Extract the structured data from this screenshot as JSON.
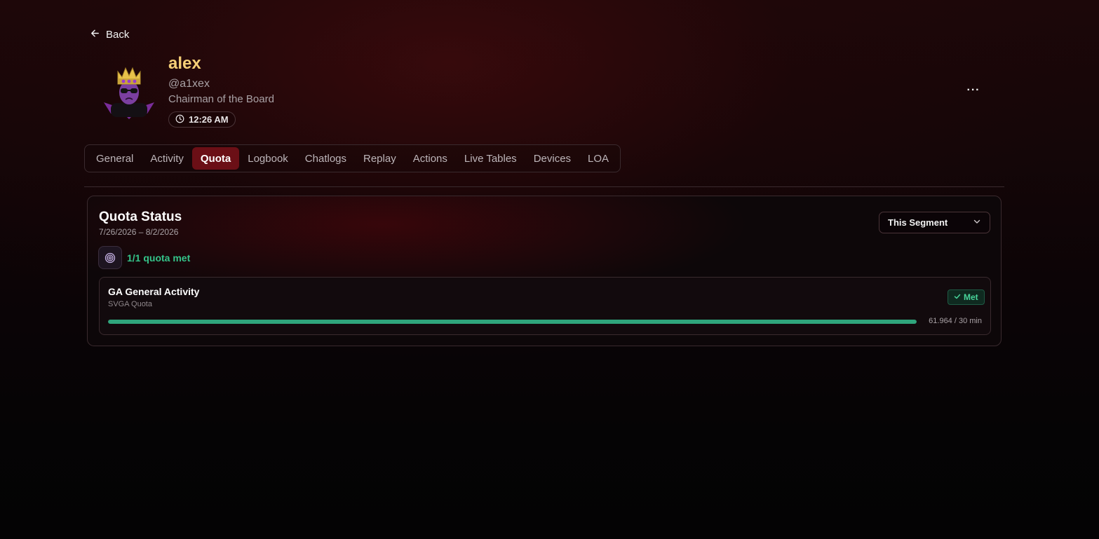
{
  "nav": {
    "back_label": "Back"
  },
  "profile": {
    "name": "alex",
    "handle": "@a1xex",
    "role": "Chairman of the Board",
    "local_time": "12:26 AM",
    "more_label": "···"
  },
  "tabs": [
    {
      "label": "General",
      "active": false
    },
    {
      "label": "Activity",
      "active": false
    },
    {
      "label": "Quota",
      "active": true
    },
    {
      "label": "Logbook",
      "active": false
    },
    {
      "label": "Chatlogs",
      "active": false
    },
    {
      "label": "Replay",
      "active": false
    },
    {
      "label": "Actions",
      "active": false
    },
    {
      "label": "Live Tables",
      "active": false
    },
    {
      "label": "Devices",
      "active": false
    },
    {
      "label": "LOA",
      "active": false
    }
  ],
  "quota": {
    "title": "Quota Status",
    "date_range": "7/26/2026 – 8/2/2026",
    "segment_select": "This Segment",
    "summary": "1/1 quota met",
    "items": [
      {
        "title": "GA General Activity",
        "subtitle": "SVGA Quota",
        "status": "Met",
        "progress_label": "61.964 / 30 min",
        "progress_fraction": 1.0
      }
    ]
  },
  "colors": {
    "accent_tab": "#6b0f16",
    "name_gold": "#f5cf77",
    "met_green": "#34c48a",
    "progress_green": "#2fa57c"
  },
  "icons": {
    "back": "arrow-left-icon",
    "clock": "clock-icon",
    "more": "ellipsis-icon",
    "chevron": "chevron-down-icon",
    "target": "target-icon",
    "check": "check-icon"
  }
}
